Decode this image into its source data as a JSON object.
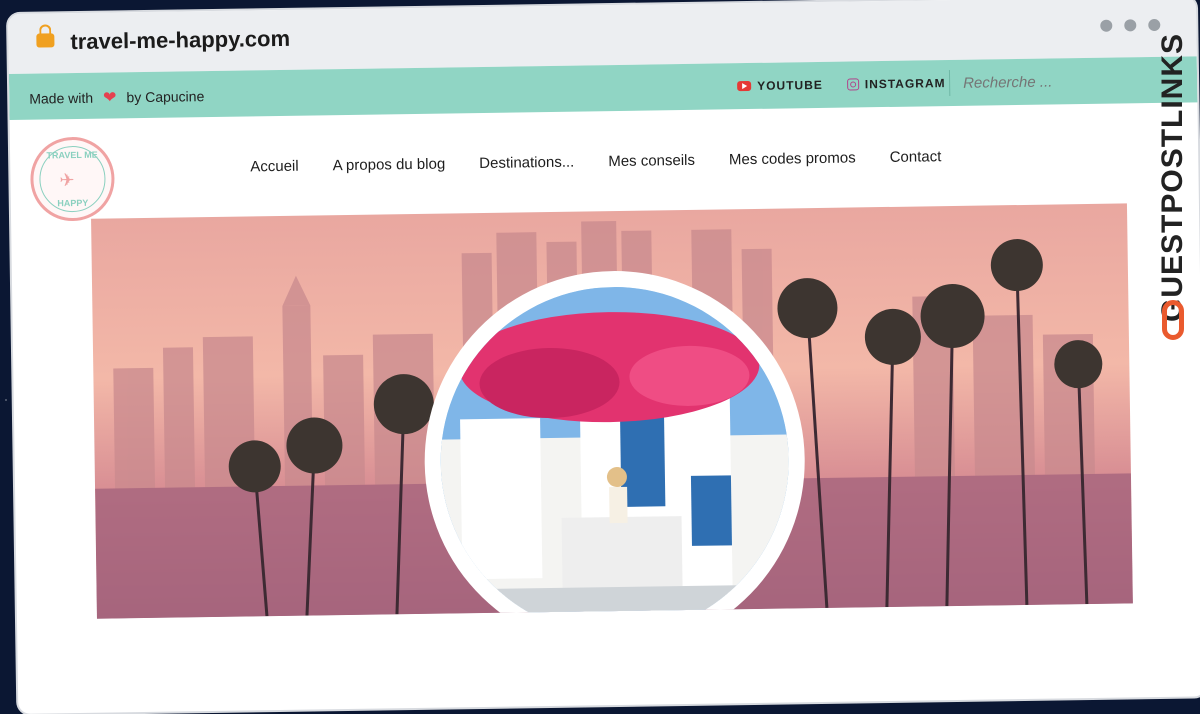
{
  "browser": {
    "url": "travel-me-happy.com"
  },
  "topbar": {
    "made_with": "Made with",
    "by": "by Capucine",
    "youtube": "YOUTUBE",
    "instagram": "INSTAGRAM",
    "search_placeholder": "Recherche ..."
  },
  "logo": {
    "top_text": "TRAVEL ME",
    "bottom_text": "HAPPY"
  },
  "nav": {
    "items": [
      "Accueil",
      "A propos du blog",
      "Destinations...",
      "Mes conseils",
      "Mes codes promos",
      "Contact"
    ]
  },
  "watermark": {
    "text": "GUESTPOSTLINKS"
  },
  "colors": {
    "topbar": "#90d5c4",
    "heart": "#e5414f",
    "logo_pink": "#f0a3a3",
    "logo_teal": "#8ad0bf",
    "watermark_accent": "#ea5a2e"
  }
}
